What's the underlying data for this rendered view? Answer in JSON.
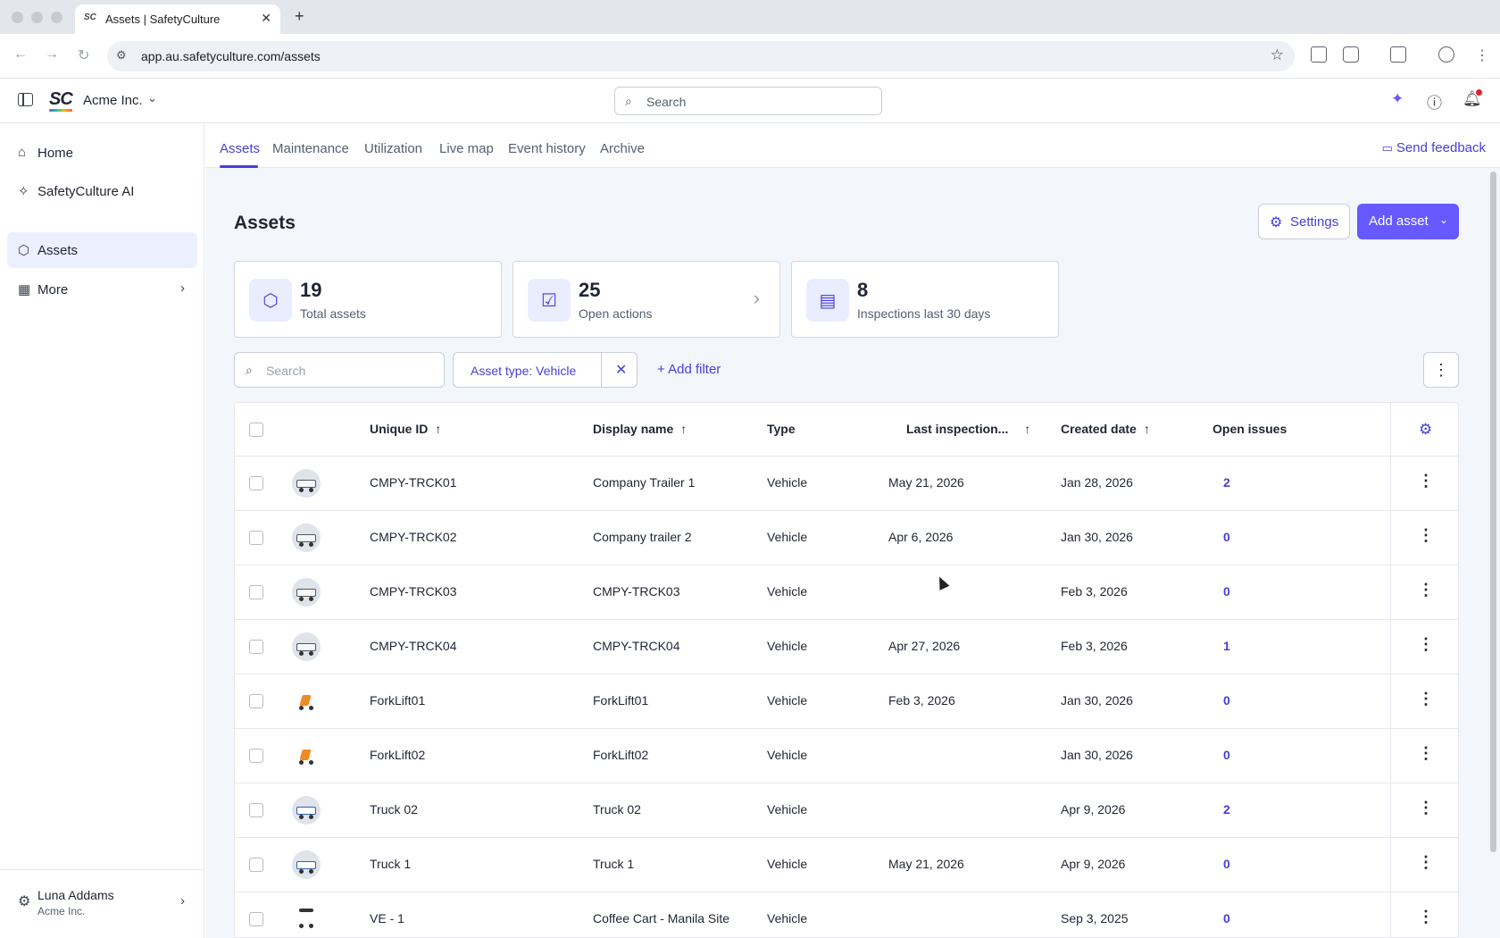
{
  "browser": {
    "tab_title": "Assets | SafetyCulture",
    "tab_favicon": "SC",
    "url": "app.au.safetyculture.com/assets"
  },
  "header": {
    "org_name": "Acme Inc.",
    "logo_text": "SC",
    "search_placeholder": "Search"
  },
  "sidebar": {
    "items": [
      {
        "label": "Home",
        "icon": "home-icon"
      },
      {
        "label": "SafetyCulture AI",
        "icon": "sparkle-icon"
      },
      {
        "label": "Assets",
        "icon": "cube-icon",
        "active": true
      },
      {
        "label": "More",
        "icon": "grid-icon"
      }
    ],
    "user": {
      "name": "Luna Addams",
      "org": "Acme Inc."
    }
  },
  "subnav": {
    "tabs": [
      "Assets",
      "Maintenance",
      "Utilization",
      "Live map",
      "Event history",
      "Archive"
    ],
    "active": "Assets",
    "feedback": "Send feedback"
  },
  "page": {
    "title": "Assets",
    "settings_label": "Settings",
    "add_asset_label": "Add asset"
  },
  "stats": [
    {
      "value": "19",
      "label": "Total assets",
      "icon": "cube-icon"
    },
    {
      "value": "25",
      "label": "Open actions",
      "icon": "actions-icon"
    },
    {
      "value": "8",
      "label": "Inspections last 30 days",
      "icon": "clipboard-icon"
    }
  ],
  "filters": {
    "search_placeholder": "Search",
    "chip": "Asset type: Vehicle",
    "add_filter": "Add filter"
  },
  "table": {
    "columns": [
      "Unique ID",
      "Display name",
      "Type",
      "Last inspection...",
      "Created date",
      "Open issues"
    ],
    "rows": [
      {
        "id": "CMPY-TRCK01",
        "name": "Company Trailer 1",
        "type": "Vehicle",
        "last": "May 21, 2026",
        "created": "Jan 28, 2026",
        "issues": "2"
      },
      {
        "id": "CMPY-TRCK02",
        "name": "Company trailer 2",
        "type": "Vehicle",
        "last": "Apr 6, 2026",
        "created": "Jan 30, 2026",
        "issues": "0"
      },
      {
        "id": "CMPY-TRCK03",
        "name": "CMPY-TRCK03",
        "type": "Vehicle",
        "last": "",
        "created": "Feb 3, 2026",
        "issues": "0"
      },
      {
        "id": "CMPY-TRCK04",
        "name": "CMPY-TRCK04",
        "type": "Vehicle",
        "last": "Apr 27, 2026",
        "created": "Feb 3, 2026",
        "issues": "1"
      },
      {
        "id": "ForkLift01",
        "name": "ForkLift01",
        "type": "Vehicle",
        "last": "Feb 3, 2026",
        "created": "Jan 30, 2026",
        "issues": "0"
      },
      {
        "id": "ForkLift02",
        "name": "ForkLift02",
        "type": "Vehicle",
        "last": "",
        "created": "Jan 30, 2026",
        "issues": "0"
      },
      {
        "id": "Truck 02",
        "name": "Truck 02",
        "type": "Vehicle",
        "last": "",
        "created": "Apr 9, 2026",
        "issues": "2"
      },
      {
        "id": "Truck 1",
        "name": "Truck 1",
        "type": "Vehicle",
        "last": "May 21, 2026",
        "created": "Apr 9, 2026",
        "issues": "0"
      },
      {
        "id": "VE - 1",
        "name": "Coffee Cart - Manila Site",
        "type": "Vehicle",
        "last": "",
        "created": "Sep 3, 2025",
        "issues": "0"
      }
    ]
  },
  "colors": {
    "accent": "#6559ff",
    "link": "#4740d4"
  }
}
